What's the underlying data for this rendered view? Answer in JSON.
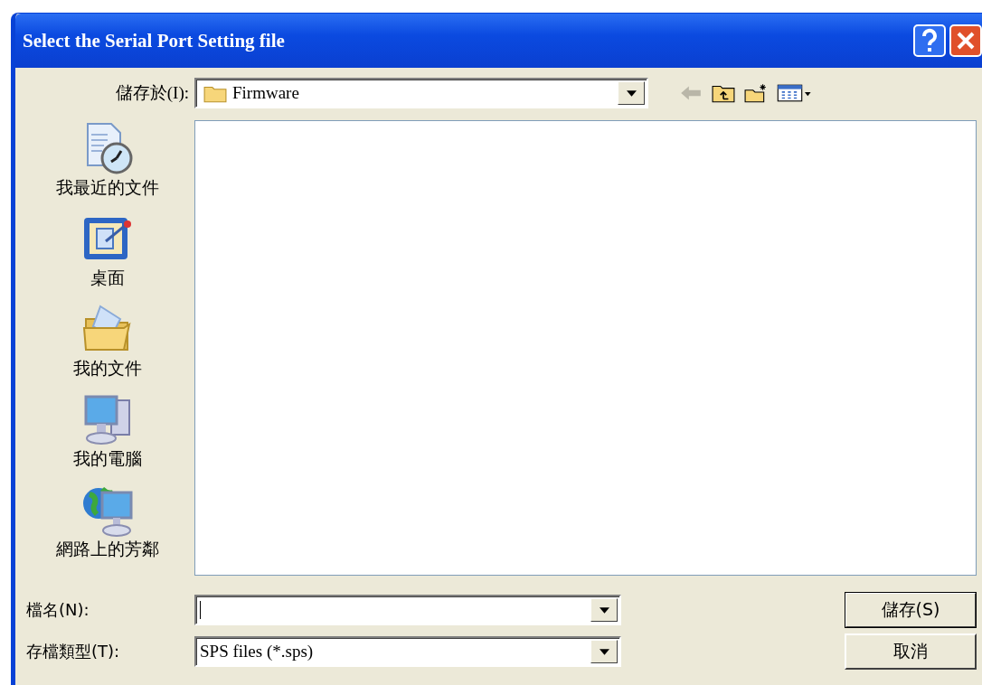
{
  "window": {
    "title": "Select the Serial Port Setting file"
  },
  "look_in": {
    "label": "儲存於(I):",
    "value": "Firmware"
  },
  "places": [
    {
      "kind": "recent",
      "label": "我最近的文件"
    },
    {
      "kind": "desktop",
      "label": "桌面"
    },
    {
      "kind": "documents",
      "label": "我的文件"
    },
    {
      "kind": "computer",
      "label": "我的電腦"
    },
    {
      "kind": "network",
      "label": "網路上的芳鄰"
    }
  ],
  "file_name": {
    "label": "檔名(N):"
  },
  "file_type": {
    "label": "存檔類型(T):",
    "value": "SPS files (*.sps)"
  },
  "buttons": [
    {
      "kind": "save",
      "label": "儲存(S)"
    },
    {
      "kind": "cancel",
      "label": "取消"
    }
  ]
}
